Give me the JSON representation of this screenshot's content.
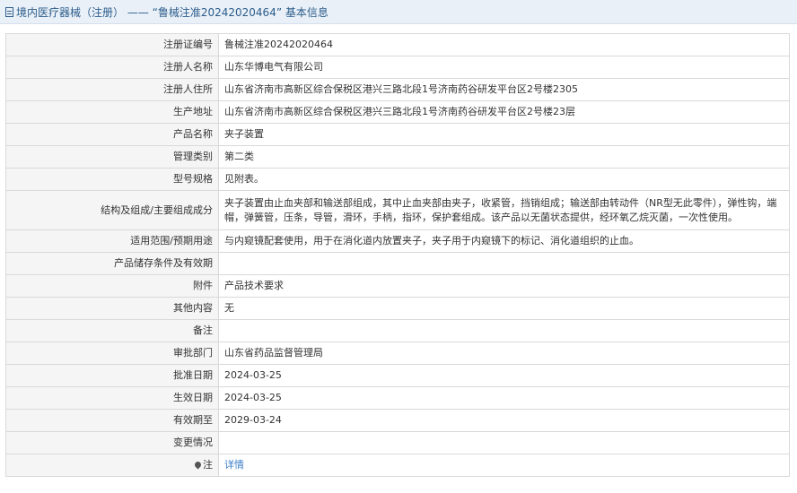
{
  "header": {
    "title": "境内医疗器械（注册） —— “鲁械注准20242020464” 基本信息"
  },
  "rows": [
    {
      "label": "注册证编号",
      "value": "鲁械注准20242020464"
    },
    {
      "label": "注册人名称",
      "value": "山东华博电气有限公司"
    },
    {
      "label": "注册人住所",
      "value": "山东省济南市高新区综合保税区港兴三路北段1号济南药谷研发平台区2号楼2305"
    },
    {
      "label": "生产地址",
      "value": "山东省济南市高新区综合保税区港兴三路北段1号济南药谷研发平台区2号楼23层"
    },
    {
      "label": "产品名称",
      "value": "夹子装置"
    },
    {
      "label": "管理类别",
      "value": "第二类"
    },
    {
      "label": "型号规格",
      "value": "见附表。"
    },
    {
      "label": "结构及组成/主要组成成分",
      "value": "夹子装置由止血夹部和输送部组成，其中止血夹部由夹子，收紧管，挡销组成；输送部由转动件（NR型无此零件），弹性钩，端帽，弹簧管，压条，导管，滑环，手柄，指环，保护套组成。该产品以无菌状态提供，经环氧乙烷灭菌，一次性使用。"
    },
    {
      "label": "适用范围/预期用途",
      "value": "与内窥镜配套使用，用于在消化道内放置夹子，夹子用于内窥镜下的标记、消化道组织的止血。"
    },
    {
      "label": "产品储存条件及有效期",
      "value": ""
    },
    {
      "label": "附件",
      "value": "产品技术要求"
    },
    {
      "label": "其他内容",
      "value": "无"
    },
    {
      "label": "备注",
      "value": ""
    },
    {
      "label": "审批部门",
      "value": "山东省药品监督管理局"
    },
    {
      "label": "批准日期",
      "value": "2024-03-25"
    },
    {
      "label": "生效日期",
      "value": "2024-03-25"
    },
    {
      "label": "有效期至",
      "value": "2029-03-24"
    },
    {
      "label": "变更情况",
      "value": ""
    }
  ],
  "note": {
    "label": "注",
    "link": "详情"
  },
  "icons": {
    "header": "document-icon",
    "note": "pin-icon"
  }
}
